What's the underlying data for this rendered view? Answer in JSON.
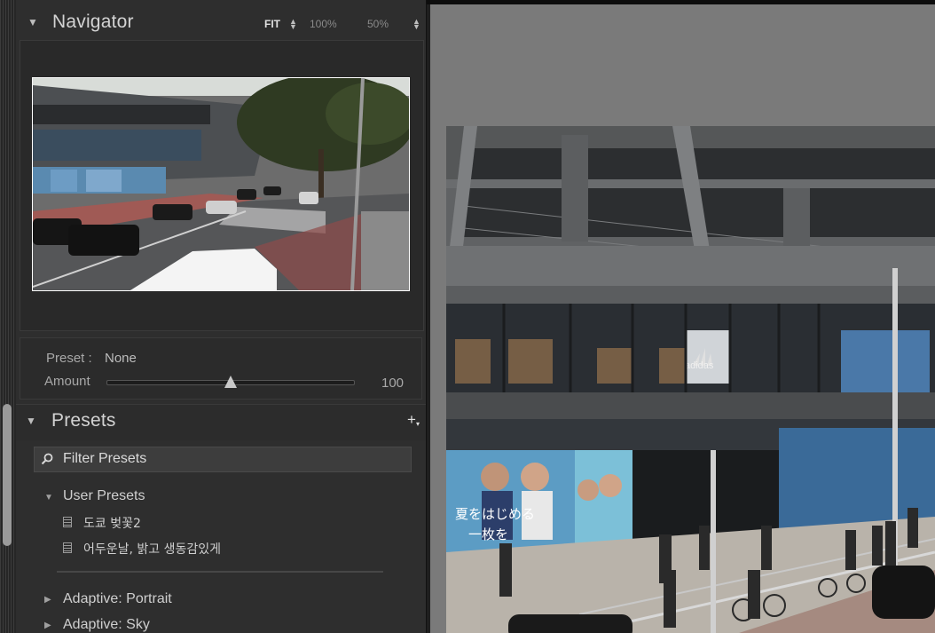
{
  "navigator": {
    "title": "Navigator",
    "zoom_options": [
      "FIT",
      "100%",
      "50%"
    ],
    "active_zoom": "FIT"
  },
  "quick_preset": {
    "preset_label": "Preset :",
    "preset_value": "None",
    "amount_label": "Amount",
    "amount_value": "100",
    "amount_fraction": 0.5
  },
  "presets": {
    "title": "Presets",
    "filter_placeholder": "Filter Presets",
    "groups": [
      {
        "label": "User Presets",
        "expanded": true,
        "items": [
          "도쿄 벚꽃2",
          "어두운날, 밝고 생동감있게"
        ]
      },
      {
        "label": "Adaptive: Portrait",
        "expanded": false
      },
      {
        "label": "Adaptive: Sky",
        "expanded": false
      }
    ]
  },
  "photo": {
    "storefront_sign": "adidas",
    "poster_text_line1": "夏をはじめる",
    "poster_text_line2": "一枚を"
  },
  "colors": {
    "panel_bg": "#2e2e2e",
    "main_bg": "#7a7a7a",
    "text": "#c8c8c8"
  }
}
